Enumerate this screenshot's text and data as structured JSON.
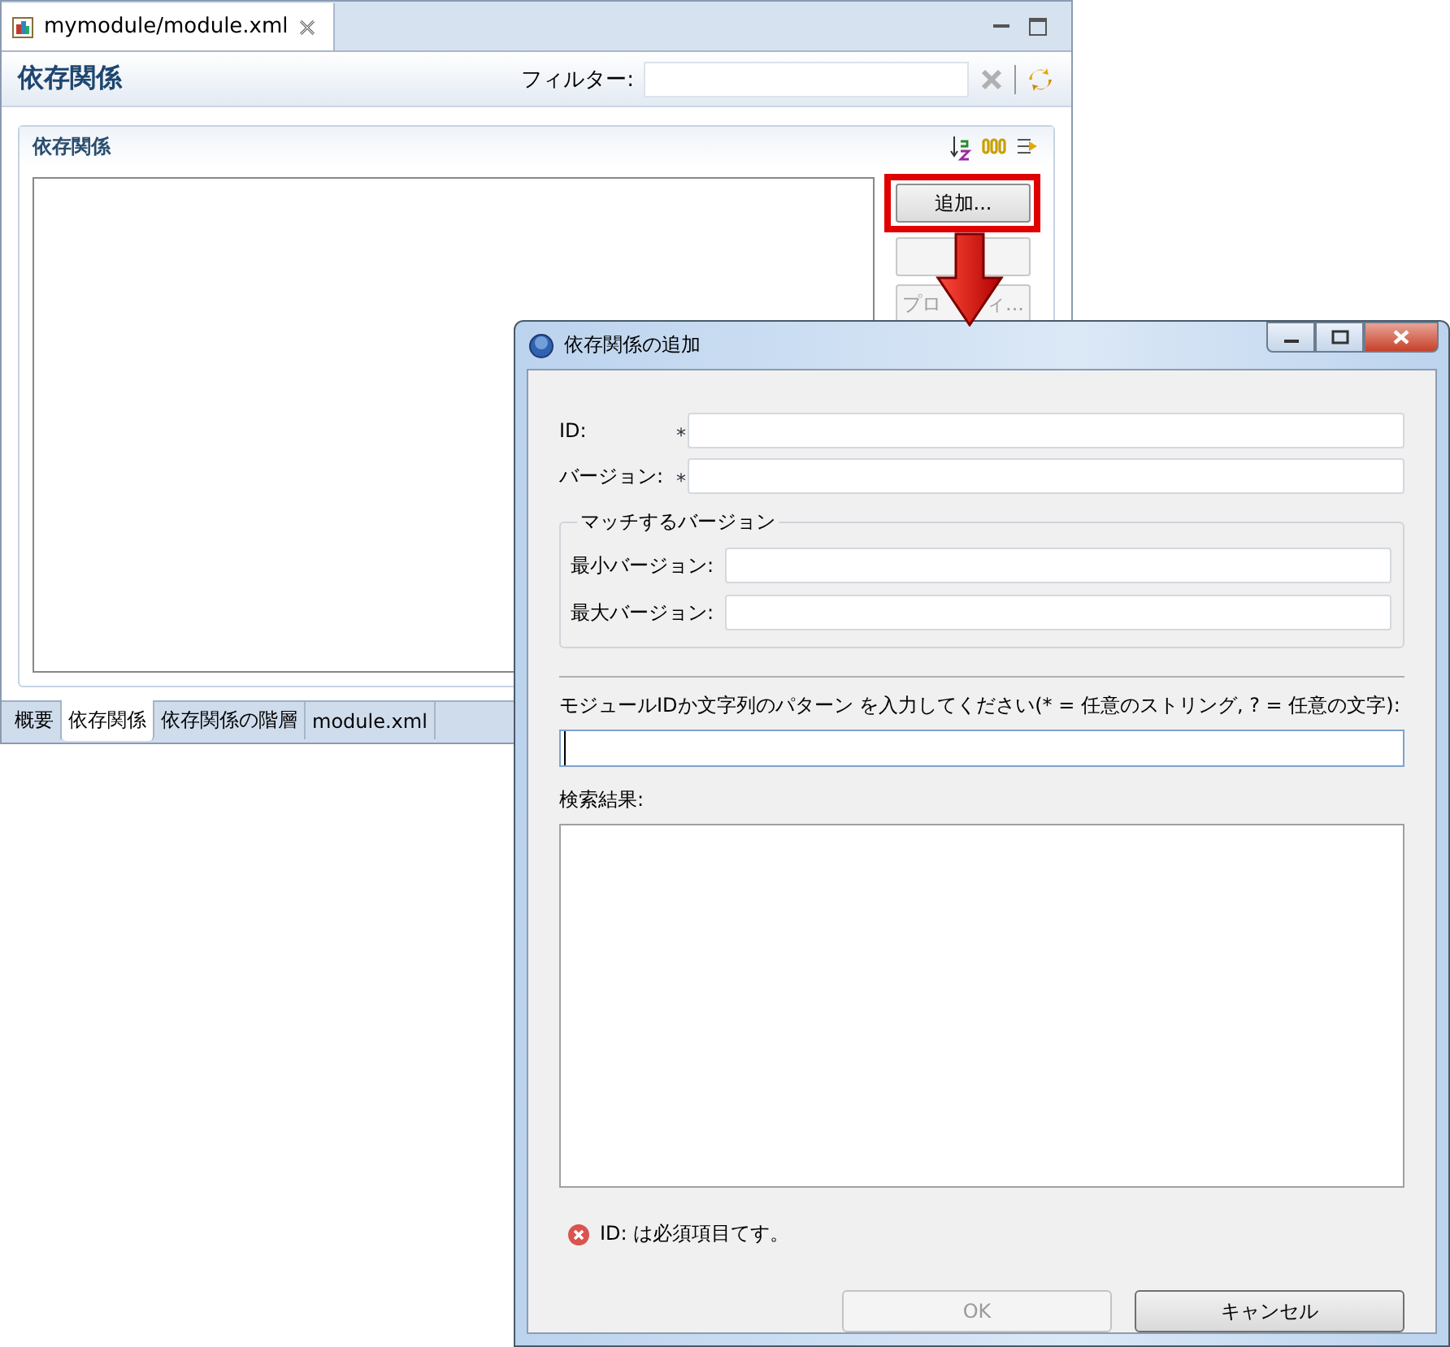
{
  "editor": {
    "tab": {
      "title": "mymodule/module.xml"
    },
    "title": "依存関係",
    "filter": {
      "label": "フィルター:"
    },
    "section": {
      "title": "依存関係"
    },
    "buttons": [
      {
        "label": "追加...",
        "disabled": false,
        "highlighted": true
      },
      {
        "disabled": true,
        "highlighted": false
      },
      {
        "label_parts": [
          "プロ",
          "ィ..."
        ],
        "disabled": true,
        "highlighted": false
      }
    ],
    "bottom_tabs": [
      {
        "label": "概要",
        "selected": false
      },
      {
        "label": "依存関係",
        "selected": true
      },
      {
        "label": "依存関係の階層",
        "selected": false
      },
      {
        "label": "module.xml",
        "selected": false
      }
    ]
  },
  "dialog": {
    "title": "依存関係の追加",
    "fields": [
      {
        "label": "ID:",
        "marker": "*"
      },
      {
        "label": "バージョン:",
        "marker": "*"
      }
    ],
    "group": {
      "title": "マッチするバージョン",
      "fields": [
        {
          "label": "最小バージョン:"
        },
        {
          "label": "最大バージョン:"
        }
      ]
    },
    "pattern": {
      "label": "モジュールIDか文字列のパターン を入力してください(* = 任意のストリング, ? = 任意の文字):",
      "focused": true
    },
    "results": {
      "label": "検索結果:"
    },
    "message": {
      "kind": "error",
      "text": "ID: は必須項目てす。"
    },
    "buttons": [
      {
        "label": "OK",
        "disabled": true
      },
      {
        "label": "キャンセル",
        "disabled": false
      }
    ]
  }
}
